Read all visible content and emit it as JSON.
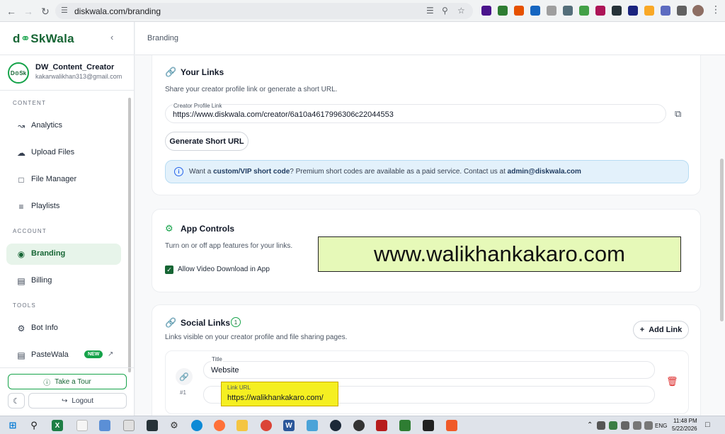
{
  "browser": {
    "url": "diskwala.com/branding",
    "extensions": [
      {
        "name": "ext-1",
        "color": "#4a148c"
      },
      {
        "name": "ext-2",
        "color": "#2e7d32"
      },
      {
        "name": "ext-3",
        "color": "#e65100"
      },
      {
        "name": "ext-4",
        "color": "#1565c0"
      },
      {
        "name": "ext-5",
        "color": "#9e9e9e"
      },
      {
        "name": "ext-6",
        "color": "#546e7a"
      },
      {
        "name": "ext-7",
        "color": "#43a047"
      },
      {
        "name": "ext-8",
        "color": "#ad1457"
      },
      {
        "name": "ext-9",
        "color": "#263238"
      },
      {
        "name": "ext-10",
        "color": "#1a237e"
      },
      {
        "name": "ext-11",
        "color": "#f9a825"
      },
      {
        "name": "ext-12",
        "color": "#5c6bc0"
      },
      {
        "name": "ext-13",
        "color": "#616161"
      }
    ]
  },
  "sidebar": {
    "logo_a": "d",
    "logo_b": "SkWala",
    "user": {
      "avatar_text": "D⊙Sk",
      "name": "DW_Content_Creator",
      "email": "kakarwalikhan313@gmail.com"
    },
    "sections": {
      "content": "CONTENT",
      "account": "ACCOUNT",
      "tools": "TOOLS"
    },
    "items": {
      "analytics": "Analytics",
      "upload": "Upload Files",
      "file_manager": "File Manager",
      "playlists": "Playlists",
      "branding": "Branding",
      "billing": "Billing",
      "bot_info": "Bot Info",
      "pastewala": "PasteWala"
    },
    "new_badge": "NEW",
    "tour": "Take a Tour",
    "logout": "Logout"
  },
  "header": {
    "breadcrumb": "Branding"
  },
  "your_links": {
    "title": "Your Links",
    "subtitle": "Share your creator profile link or generate a short URL.",
    "field_label": "Creator Profile Link",
    "field_value": "https://www.diskwala.com/creator/6a10a4617996306c22044553",
    "generate_btn": "Generate Short URL",
    "info_pre": "Want a ",
    "info_bold": "custom/VIP short code",
    "info_mid": "? Premium short codes are available as a paid service. Contact us at ",
    "info_email": "admin@diskwala.com"
  },
  "app_controls": {
    "title": "App Controls",
    "subtitle": "Turn on or off app features for your links.",
    "checkbox_label": "Allow Video Download in App",
    "watermark": "www.walikhankakaro.com"
  },
  "social_links": {
    "title": "Social Links",
    "count": "1",
    "subtitle": "Links visible on your creator profile and file sharing pages.",
    "add_btn": "Add Link",
    "item": {
      "number": "#1",
      "title_label": "Title",
      "title_value": "Website",
      "url_label": "Link URL",
      "url_value": "https://walikhankakaro.com/"
    }
  },
  "taskbar": {
    "lang": "ENG",
    "time": "11:48 PM",
    "date": "5/22/2026"
  }
}
